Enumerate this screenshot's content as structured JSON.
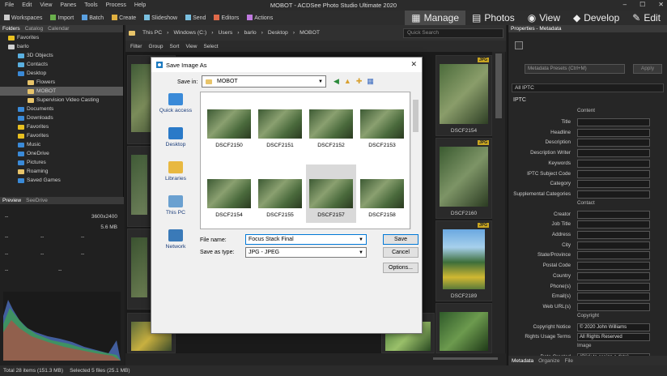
{
  "app": {
    "title": "MOBOT - ACDSee Photo Studio Ultimate 2020",
    "menu": [
      "File",
      "Edit",
      "View",
      "Panes",
      "Tools",
      "Process",
      "Help"
    ]
  },
  "toolbar": {
    "items": [
      "Workspaces",
      "Import",
      "Batch",
      "Create",
      "Slideshow",
      "Send",
      "Editors",
      "Actions"
    ]
  },
  "modes": [
    "Manage",
    "Photos",
    "View",
    "Develop",
    "Edit"
  ],
  "left_panel": {
    "tabs": [
      "Folders",
      "Catalog",
      "Calendar"
    ],
    "tree": [
      {
        "label": "Favorites",
        "indent": 1
      },
      {
        "label": "barlo",
        "indent": 1
      },
      {
        "label": "3D Objects",
        "indent": 3
      },
      {
        "label": "Contacts",
        "indent": 3
      },
      {
        "label": "Desktop",
        "indent": 3
      },
      {
        "label": "Flowers",
        "indent": 5
      },
      {
        "label": "MOBOT",
        "indent": 5,
        "selected": true
      },
      {
        "label": "Supervision Video Casting",
        "indent": 5
      },
      {
        "label": "Documents",
        "indent": 3
      },
      {
        "label": "Downloads",
        "indent": 3
      },
      {
        "label": "Favorites",
        "indent": 3
      },
      {
        "label": "Favorites",
        "indent": 3
      },
      {
        "label": "Music",
        "indent": 3
      },
      {
        "label": "OneDrive",
        "indent": 3
      },
      {
        "label": "Pictures",
        "indent": 3
      },
      {
        "label": "Roaming",
        "indent": 3
      },
      {
        "label": "Saved Games",
        "indent": 3
      }
    ]
  },
  "preview": {
    "tabs": [
      "Preview",
      "SeeDrive"
    ],
    "dims": "3600x2400",
    "size": "5.6 MB",
    "placeholders": [
      "--",
      "--",
      "--",
      "--",
      "--",
      "--",
      "--",
      "--",
      "--"
    ]
  },
  "address": {
    "path": [
      "This PC",
      "Windows (C:)",
      "Users",
      "barlo",
      "Desktop",
      "MOBOT"
    ],
    "search_placeholder": "Quick Search"
  },
  "filter": {
    "items": [
      "Filter",
      "Group",
      "Sort",
      "View",
      "Select"
    ]
  },
  "grid": {
    "labels": [
      "DSCF2154",
      "DSCF2160",
      "DSCF2189"
    ],
    "badge": "JPG"
  },
  "status": {
    "total": "Total 28 items  (151.3 MB)",
    "selected": "Selected 5 files (25.1 MB)"
  },
  "right_panel": {
    "title": "Properties - Metadata",
    "preset": "Metadata Presets (Ctrl+M)",
    "apply": "Apply",
    "filter": "All IPTC",
    "section": "IPTC",
    "groups": {
      "content": "Content",
      "contact": "Contact",
      "copyright": "Copyright",
      "image": "Image"
    },
    "content_fields": [
      "Title",
      "Headline",
      "Description",
      "Description Writer",
      "Keywords",
      "IPTC Subject Code",
      "Category",
      "Supplemental Categories"
    ],
    "contact_fields": [
      "Creator",
      "Job Title",
      "Address",
      "City",
      "State/Province",
      "Postal Code",
      "Country",
      "Phone(s)",
      "Email(s)",
      "Web URL(s)"
    ],
    "copyright_fields": [
      {
        "k": "Copyright Notice",
        "v": "© 2020 John Williams"
      },
      {
        "k": "Rights Usage Terms",
        "v": "All Rights Reserved"
      }
    ],
    "date_field": {
      "k": "Date Created",
      "v": "(Click to assign a date)"
    },
    "bottom_tabs": [
      "Metadata",
      "Organize",
      "File"
    ]
  },
  "dialog": {
    "title": "Save Image As",
    "save_in_label": "Save in:",
    "save_in": "MOBOT",
    "places": [
      "Quick access",
      "Desktop",
      "Libraries",
      "This PC",
      "Network"
    ],
    "files": [
      "DSCF2150",
      "DSCF2151",
      "DSCF2152",
      "DSCF2153",
      "DSCF2154",
      "DSCF2155",
      "DSCF2157",
      "DSCF2158"
    ],
    "file_name_label": "File name:",
    "file_name": "Focus Stack Final",
    "save_as_label": "Save as type:",
    "save_as": "JPG - JPEG",
    "save_btn": "Save",
    "cancel_btn": "Cancel",
    "options_btn": "Options..."
  }
}
